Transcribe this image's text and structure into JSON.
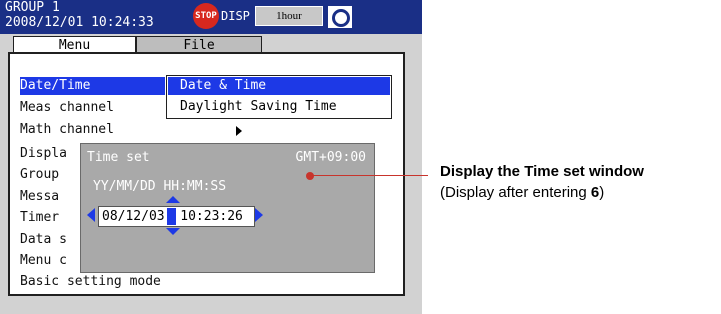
{
  "status_bar": {
    "group_name": "GROUP 1",
    "datetime": "2008/12/01 10:24:33",
    "stop_icon_label": "STOP",
    "disp_label": "DISP",
    "trend_interval": "1hour",
    "camera_icon": "camera-icon"
  },
  "tabs": {
    "menu": "Menu",
    "file": "File"
  },
  "menu_items": [
    "Date/Time",
    "Meas channel",
    "Math channel",
    "Displa",
    "Group",
    "Messa",
    "Timer",
    "Data s",
    "Menu c",
    "Basic setting mode"
  ],
  "submenu": {
    "item1": "Date & Time",
    "item2": "Daylight Saving Time"
  },
  "time_set": {
    "title": "Time set",
    "timezone": "GMT+09:00",
    "format": "YY/MM/DD  HH:MM:SS",
    "value": "08/12/03  10:23:26"
  },
  "callout": {
    "title": "Display the Time set window",
    "note_prefix": "(Display after entering ",
    "note_key": "6",
    "note_suffix": ")"
  },
  "colors": {
    "status_bar": "#1a2f86",
    "highlight": "#1d39e6",
    "callout_line": "#c8342c"
  }
}
